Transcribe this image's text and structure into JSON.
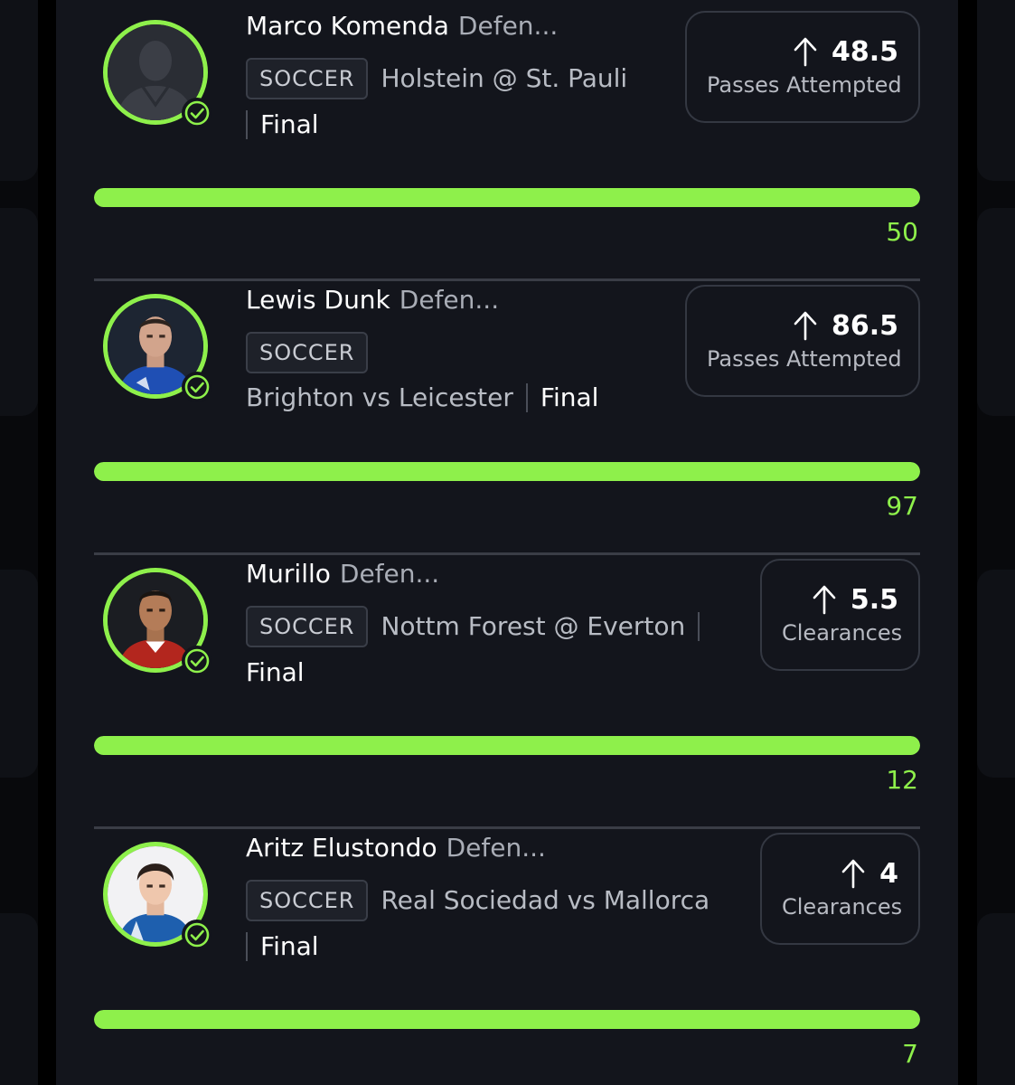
{
  "colors": {
    "accent": "#8ef04b",
    "panel": "#13151c",
    "muted_text": "#a9adb6",
    "border": "#343842"
  },
  "picks": [
    {
      "name": "Marco Komenda",
      "position": "Defen...",
      "sport": "SOCCER",
      "game": "Holstein @ St. Pauli",
      "status": "Final",
      "direction_icon": "arrow-up-icon",
      "line": "48.5",
      "stat": "Passes Attempted",
      "actual": "50",
      "progress": 1.0,
      "avatar": "placeholder-silhouette"
    },
    {
      "name": "Lewis Dunk",
      "position": "Defen...",
      "sport": "SOCCER",
      "game": "Brighton vs Leicester",
      "status": "Final",
      "direction_icon": "arrow-up-icon",
      "line": "86.5",
      "stat": "Passes Attempted",
      "actual": "97",
      "progress": 1.0,
      "avatar": "player-photo"
    },
    {
      "name": "Murillo",
      "position": "Defen...",
      "sport": "SOCCER",
      "game": "Nottm Forest @ Everton",
      "status": "Final",
      "direction_icon": "arrow-up-icon",
      "line": "5.5",
      "stat": "Clearances",
      "actual": "12",
      "progress": 1.0,
      "avatar": "player-photo"
    },
    {
      "name": "Aritz Elustondo",
      "position": "Defen...",
      "sport": "SOCCER",
      "game": "Real Sociedad vs Mallorca",
      "status": "Final",
      "direction_icon": "arrow-up-icon",
      "line": "4",
      "stat": "Clearances",
      "actual": "7",
      "progress": 1.0,
      "avatar": "player-photo"
    }
  ]
}
